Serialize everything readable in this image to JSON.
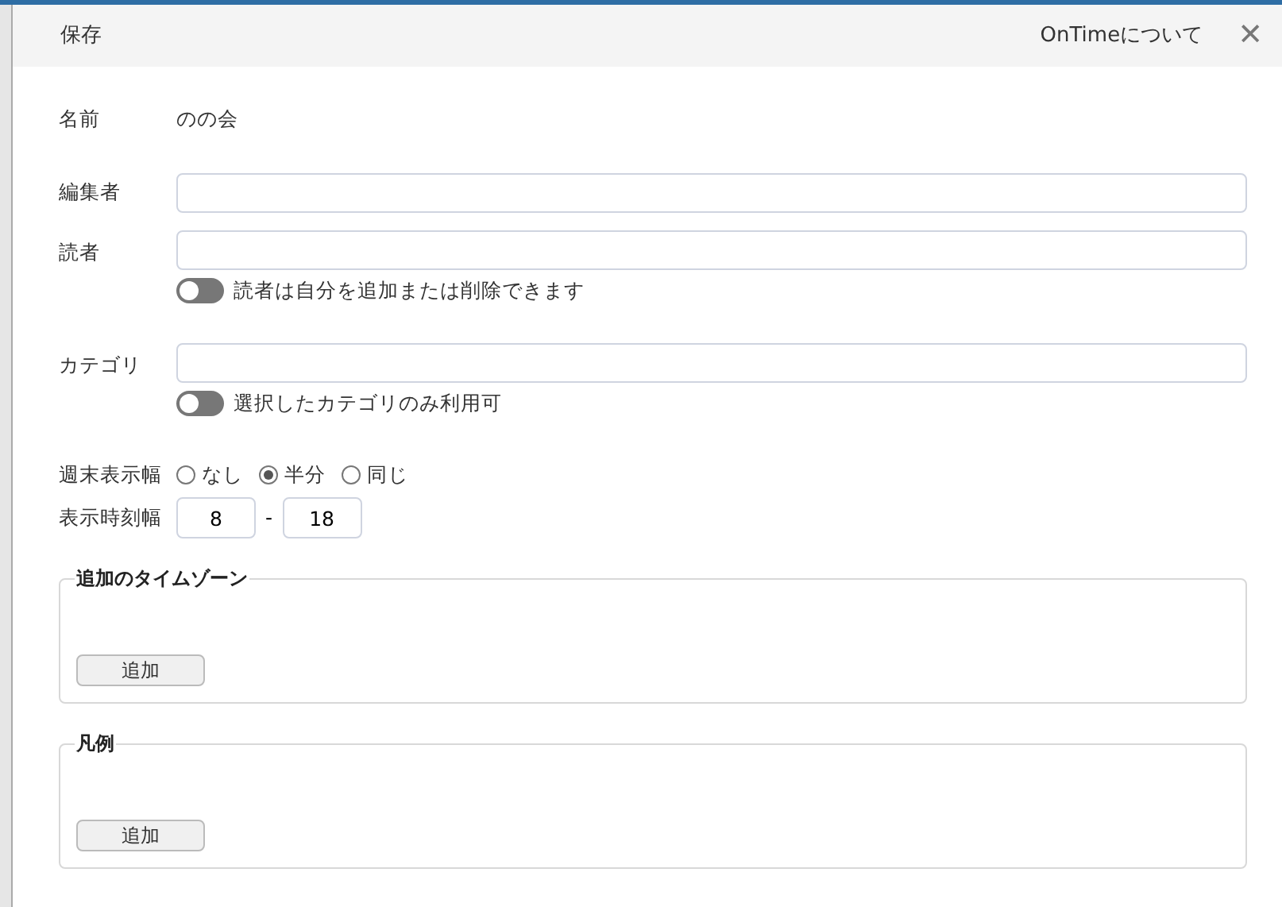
{
  "header": {
    "save": "保存",
    "about": "OnTimeについて",
    "close": "✕"
  },
  "name_row": {
    "label": "名前",
    "value": "のの会"
  },
  "editors": {
    "label": "編集者"
  },
  "readers": {
    "label": "読者",
    "toggle": {
      "label": "読者は自分を追加または削除できます",
      "on": false
    }
  },
  "category": {
    "label": "カテゴリ",
    "toggle": {
      "label": "選択したカテゴリのみ利用可",
      "on": false
    }
  },
  "weekend": {
    "label": "週末表示幅",
    "options": [
      {
        "label": "なし",
        "selected": false
      },
      {
        "label": "半分",
        "selected": true
      },
      {
        "label": "同じ",
        "selected": false
      }
    ]
  },
  "hours": {
    "label": "表示時刻幅",
    "from": "8",
    "separator": "-",
    "to": "18"
  },
  "groups": [
    {
      "legend": "追加のタイムゾーン",
      "button": "追加"
    },
    {
      "legend": "凡例",
      "button": "追加"
    }
  ]
}
